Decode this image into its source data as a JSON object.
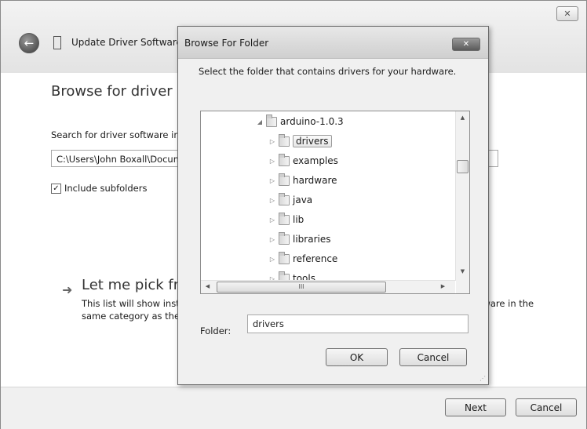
{
  "wizard": {
    "title": "Update Driver Software",
    "close_glyph": "✕",
    "back_glyph": "←",
    "heading": "Browse for driver software on your computer",
    "search_label": "Search for driver software in this location:",
    "path_value": "C:\\Users\\John Boxall\\Documents",
    "include_subfolders_label": "Include subfolders",
    "include_subfolders_checked_glyph": "✓",
    "pick_arrow_glyph": "➜",
    "pick_title": "Let me pick from a list of device drivers on my computer",
    "pick_description": "This list will show installed driver software compatible with the device, and all driver software in the same category as the device.",
    "next_label": "Next",
    "cancel_label": "Cancel"
  },
  "dialog": {
    "title": "Browse For Folder",
    "close_glyph": "✕",
    "instruction": "Select the folder that contains drivers for your hardware.",
    "tree": {
      "parent": {
        "label": "arduino-1.0.3",
        "twisty": "◢"
      },
      "children": [
        {
          "label": "drivers",
          "twisty": "▷",
          "selected": true
        },
        {
          "label": "examples",
          "twisty": "▷"
        },
        {
          "label": "hardware",
          "twisty": "▷"
        },
        {
          "label": "java",
          "twisty": "▷"
        },
        {
          "label": "lib",
          "twisty": "▷"
        },
        {
          "label": "libraries",
          "twisty": "▷"
        },
        {
          "label": "reference",
          "twisty": "▷"
        },
        {
          "label": "tools",
          "twisty": "▷"
        }
      ]
    },
    "scroll": {
      "up": "▲",
      "down": "▼",
      "left": "◀",
      "right": "▶",
      "grip": "III"
    },
    "folder_label": "Folder:",
    "folder_value": "drivers",
    "ok_label": "OK",
    "cancel_label": "Cancel",
    "resize_grip": "⋰"
  }
}
